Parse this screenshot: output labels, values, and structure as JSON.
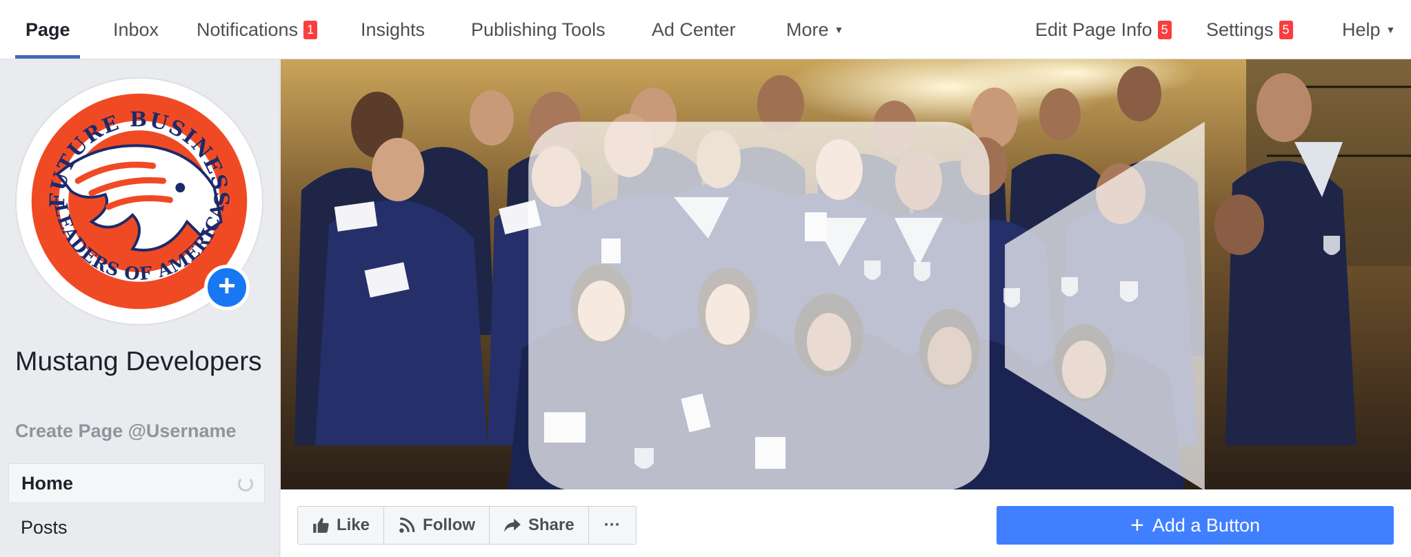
{
  "topnav": {
    "items": [
      {
        "label": "Page",
        "active": true
      },
      {
        "label": "Inbox"
      },
      {
        "label": "Notifications",
        "badge": "1"
      },
      {
        "label": "Insights"
      },
      {
        "label": "Publishing Tools"
      },
      {
        "label": "Ad Center"
      },
      {
        "label": "More"
      }
    ],
    "right_items": [
      {
        "label": "Edit Page Info",
        "badge": "5"
      },
      {
        "label": "Settings",
        "badge": "5"
      },
      {
        "label": "Help"
      }
    ]
  },
  "sidebar": {
    "page_name": "Mustang Developers",
    "username_link": "Create Page @Username",
    "menu": [
      {
        "label": "Home",
        "selected": true
      },
      {
        "label": "Posts"
      }
    ]
  },
  "profile_logo": {
    "top_text": "FUTURE BUSINESS",
    "bottom_text": "LEADERS OF AMERICA"
  },
  "actions": {
    "like": "Like",
    "follow": "Follow",
    "share": "Share",
    "more": "···",
    "add_button": "Add a Button",
    "add_button_icon": "+"
  },
  "colors": {
    "accent": "#4267b2",
    "cta": "#4080ff",
    "badge": "#fa3e3e",
    "logo_orange": "#f04a24",
    "logo_navy": "#1c2a6b"
  }
}
